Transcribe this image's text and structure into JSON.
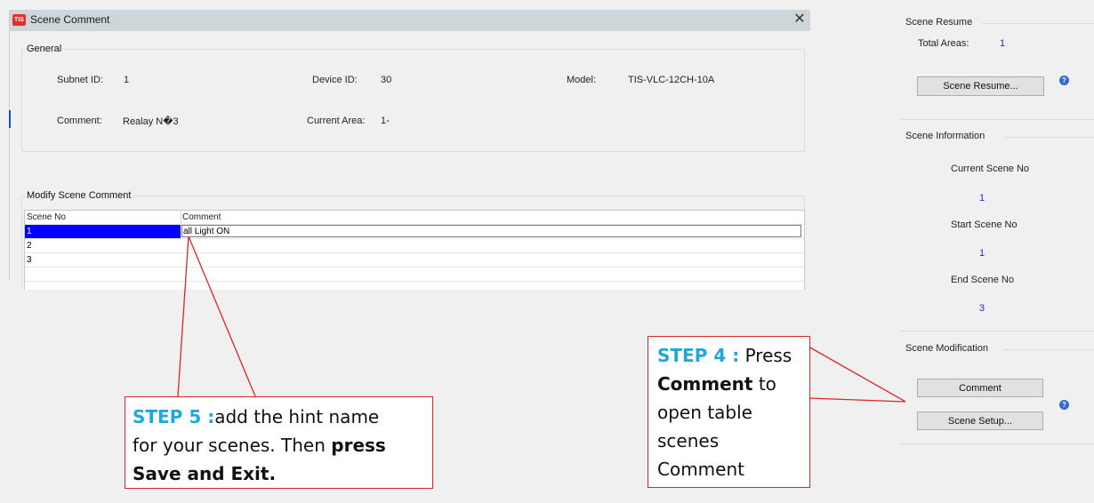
{
  "window": {
    "title": "Scene Comment",
    "app_icon_text": "TIS",
    "close_glyph": "✕"
  },
  "general": {
    "legend": "General",
    "subnet_label": "Subnet ID:",
    "subnet_value": "1",
    "device_label": "Device ID:",
    "device_value": "30",
    "model_label": "Model:",
    "model_value": "TIS-VLC-12CH-10A",
    "comment_label": "Comment:",
    "comment_value": "Realay N�3",
    "area_label": "Current Area:",
    "area_value": "1-"
  },
  "modify": {
    "legend": "Modify Scene Comment",
    "columns": [
      "Scene No",
      "Comment"
    ],
    "rows": [
      {
        "scene": "1",
        "comment": "all Light ON"
      },
      {
        "scene": "2",
        "comment": ""
      },
      {
        "scene": "3",
        "comment": ""
      }
    ]
  },
  "right_panel": {
    "resume_title": "Scene Resume",
    "total_areas_label": "Total Areas:",
    "total_areas_value": "1",
    "resume_button": "Scene Resume...",
    "info_title": "Scene Information",
    "current_scene_label": "Current Scene No",
    "current_scene_value": "1",
    "start_scene_label": "Start Scene No",
    "start_scene_value": "1",
    "end_scene_label": "End Scene No",
    "end_scene_value": "3",
    "modification_title": "Scene Modification",
    "comment_button": "Comment",
    "setup_button": "Scene Setup...",
    "help_glyph": "?"
  },
  "callouts": {
    "step5_tag": "STEP 5 :",
    "step5_text1": "add the hint name",
    "step5_text2": "for your scenes. Then ",
    "step5_bold1": "press",
    "step5_bold2": "Save and Exit.",
    "step4_tag": "STEP 4 :",
    "step4_text1": " Press",
    "step4_bold": "Comment",
    "step4_text2": " to",
    "step4_line3": "open table",
    "step4_line4": "scenes",
    "step4_line5": "Comment"
  },
  "colors": {
    "selection": "#0000ff",
    "callout_border": "#d8262c",
    "step_tag": "#21a7dc",
    "value_blue": "#1a2bd1"
  }
}
